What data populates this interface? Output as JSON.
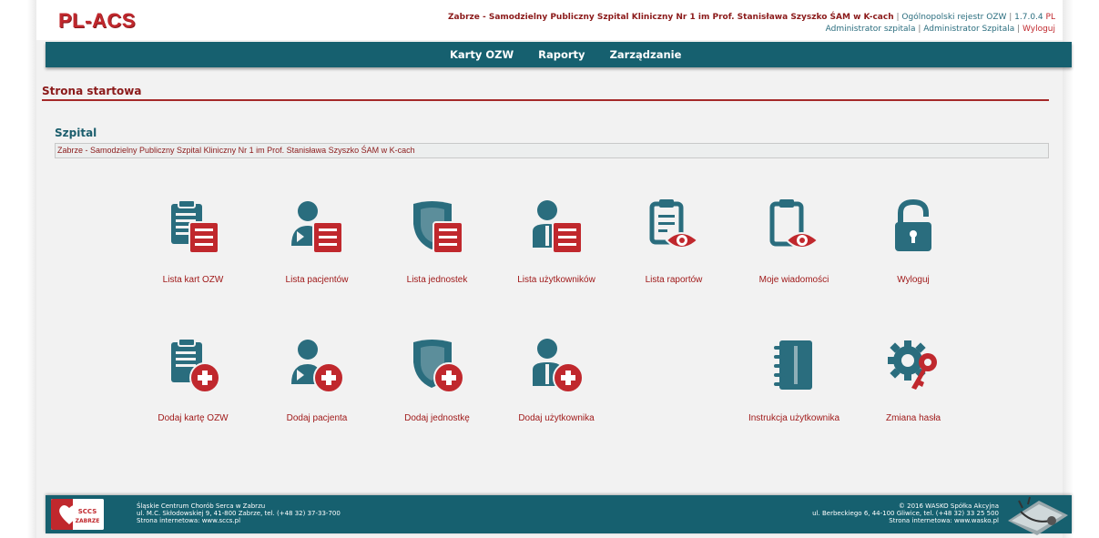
{
  "header": {
    "logo": "PL-ACS",
    "hospital": "Zabrze - Samodzielny Publiczny Szpital Kliniczny Nr 1 im Prof. Stanisława Szyszko ŚAM w K-cach",
    "sep1": " | ",
    "registry": "Ogólnopolski rejestr OZW",
    "sep2": " | ",
    "version": "1.7.0.4",
    "lang": "PL",
    "role1": "Administrator szpitala",
    "sep3": " | ",
    "role2": "Administrator Szpitala",
    "sep4": " | ",
    "logout": "Wyloguj"
  },
  "nav": {
    "items": [
      "Karty OZW",
      "Raporty",
      "Zarządzanie"
    ]
  },
  "page": {
    "title": "Strona startowa",
    "section_title": "Szpital",
    "hospital_value": "Zabrze - Samodzielny Publiczny Szpital Kliniczny Nr 1 im Prof. Stanisława Szyszko ŚAM w K-cach"
  },
  "tiles_row1": [
    {
      "label": "Lista kart OZW",
      "icon": "clipboard-list-icon"
    },
    {
      "label": "Lista pacjentów",
      "icon": "patient-list-icon"
    },
    {
      "label": "Lista jednostek",
      "icon": "shield-list-icon"
    },
    {
      "label": "Lista użytkowników",
      "icon": "user-list-icon"
    },
    {
      "label": "Lista raportów",
      "icon": "report-view-icon"
    },
    {
      "label": "Moje wiadomości",
      "icon": "messages-view-icon"
    },
    {
      "label": "Wyloguj",
      "icon": "unlock-icon"
    }
  ],
  "tiles_row2": [
    {
      "label": "Dodaj kartę OZW",
      "icon": "clipboard-add-icon"
    },
    {
      "label": "Dodaj pacjenta",
      "icon": "patient-add-icon"
    },
    {
      "label": "Dodaj jednostkę",
      "icon": "shield-add-icon"
    },
    {
      "label": "Dodaj użytkownika",
      "icon": "user-add-icon"
    },
    {
      "label": "Instrukcja użytkownika",
      "icon": "notebook-icon"
    },
    {
      "label": "Zmiana hasła",
      "icon": "gear-key-icon"
    }
  ],
  "footer": {
    "logo_text": "SCCS ZABRZE",
    "left_line1": "Śląskie Centrum Chorób Serca w Zabrzu",
    "left_line2": "ul. M.C. Skłodowskiej 9, 41-800 Zabrze, tel. (+48 32) 37-33-700",
    "left_line3": "Strona internetowa: www.sccs.pl",
    "right_line1": "© 2016 WASKO Spółka Akcyjna",
    "right_line2": "ul. Berbeckiego 6, 44-100 Gliwice, tel. (+48 32) 33 25 500",
    "right_line3": "Strona internetowa: www.wasko.pl"
  },
  "colors": {
    "teal": "#16606f",
    "icon_teal": "#2a6d7e",
    "red": "#c0282d",
    "dark_red": "#8b1a1a",
    "background": "#f2f2f2"
  }
}
